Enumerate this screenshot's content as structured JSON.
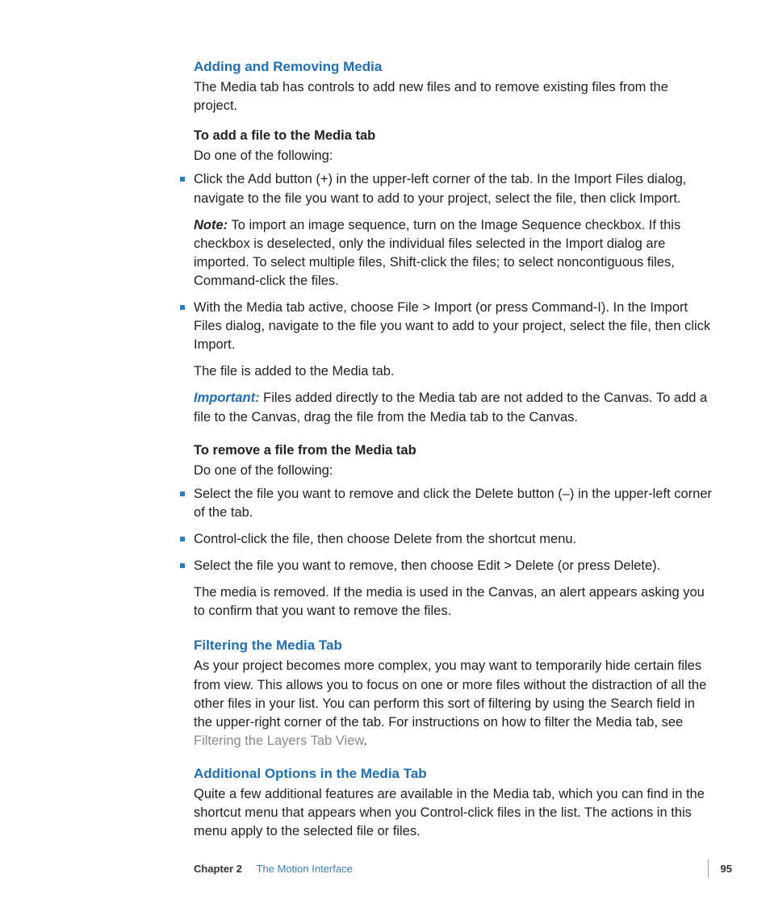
{
  "section1": {
    "title": "Adding and Removing Media",
    "intro": "The Media tab has controls to add new files and to remove existing files from the project.",
    "addHeading": "To add a file to the Media tab",
    "doOne": "Do one of the following:",
    "bullets1": {
      "b1": "Click the Add button (+) in the upper-left corner of the tab. In the Import Files dialog, navigate to the file you want to add to your project, select the file, then click Import.",
      "noteLabel": "Note:",
      "noteText": " To import an image sequence, turn on the Image Sequence checkbox. If this checkbox is deselected, only the individual files selected in the Import dialog are imported. To select multiple files, Shift-click the files; to select noncontiguous files, Command-click the files.",
      "b2": "With the Media tab active, choose File > Import (or press Command-I). In the Import Files dialog, navigate to the file you want to add to your project, select the file, then click Import.",
      "b2after": "The file is added to the Media tab.",
      "importantLabel": "Important:",
      "importantText": " Files added directly to the Media tab are not added to the Canvas. To add a file to the Canvas, drag the file from the Media tab to the Canvas."
    },
    "removeHeading": "To remove a file from the Media tab",
    "doOneB": "Do one of the following:",
    "bullets2": {
      "b1": "Select the file you want to remove and click the Delete button (–) in the upper-left corner of the tab.",
      "b2": "Control-click the file, then choose Delete from the shortcut menu.",
      "b3": "Select the file you want to remove, then choose Edit > Delete (or press Delete).",
      "after": "The media is removed. If the media is used in the Canvas, an alert appears asking you to confirm that you want to remove the files."
    }
  },
  "section2": {
    "title": "Filtering the Media Tab",
    "body1": "As your project becomes more complex, you may want to temporarily hide certain files from view. This allows you to focus on one or more files without the distraction of all the other files in your list. You can perform this sort of filtering by using the Search field in the upper-right corner of the tab. For instructions on how to filter the Media tab, see ",
    "link": "Filtering the Layers Tab View",
    "period": "."
  },
  "section3": {
    "title": "Additional Options in the Media Tab",
    "body": "Quite a few additional features are available in the Media tab, which you can find in the shortcut menu that appears when you Control-click files in the list. The actions in this menu apply to the selected file or files."
  },
  "footer": {
    "chapterLabel": "Chapter 2",
    "chapterName": "The Motion Interface",
    "page": "95"
  }
}
